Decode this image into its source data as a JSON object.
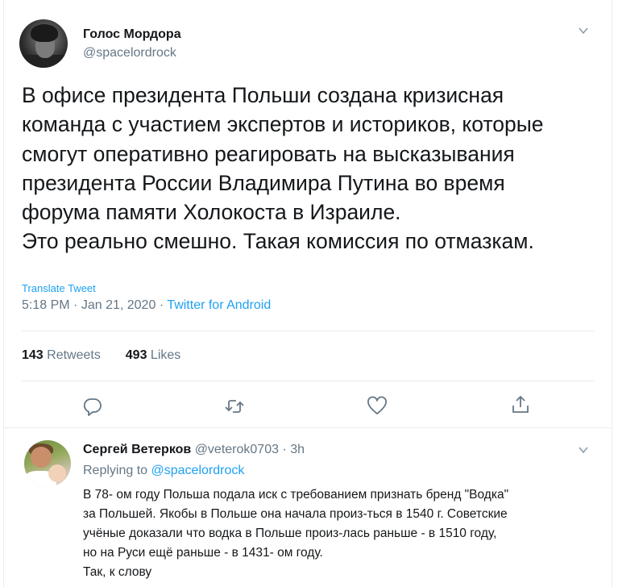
{
  "tweet": {
    "author_name": "Голос Мордора",
    "author_handle": "@spacelordrock",
    "text_lines": [
      "В офисе президента Польши создана кризисная",
      "команда с участием экспертов и историков, которые",
      "смогут оперативно реагировать на высказывания",
      "президента России Владимира Путина во время",
      "форума памяти Холокоста в Израиле.",
      "Это реально смешно. Такая комиссия по отмазкам."
    ],
    "translate_label": "Translate Tweet",
    "time": "5:18 PM",
    "date": "Jan 21, 2020",
    "source": "Twitter for Android",
    "retweets_count": "143",
    "retweets_label": "Retweets",
    "likes_count": "493",
    "likes_label": "Likes"
  },
  "actions": {
    "icons": [
      "reply-icon",
      "retweet-icon",
      "like-icon",
      "share-icon"
    ]
  },
  "reply": {
    "author_name": "Сергей Ветерков",
    "author_handle": "@veterok0703",
    "time_ago": "3h",
    "replying_prefix": "Replying to",
    "replying_to": "@spacelordrock",
    "text_lines": [
      "В 78- ом году Польша подала иск с требованием признать бренд \"Водка\"",
      "за Польшей. Якобы в Польше она начала произ-ться в 1540 г. Советские",
      "учёные доказали что водка в Польше произ-лась раньше - в 1510 году,",
      "но на Руси ещё раньше - в 1431- ом году.",
      "Так, к слову"
    ]
  },
  "colors": {
    "accent": "#1da1f2",
    "secondary_text": "#657786",
    "primary_text": "#14171a",
    "divider": "#e6ecf0"
  }
}
